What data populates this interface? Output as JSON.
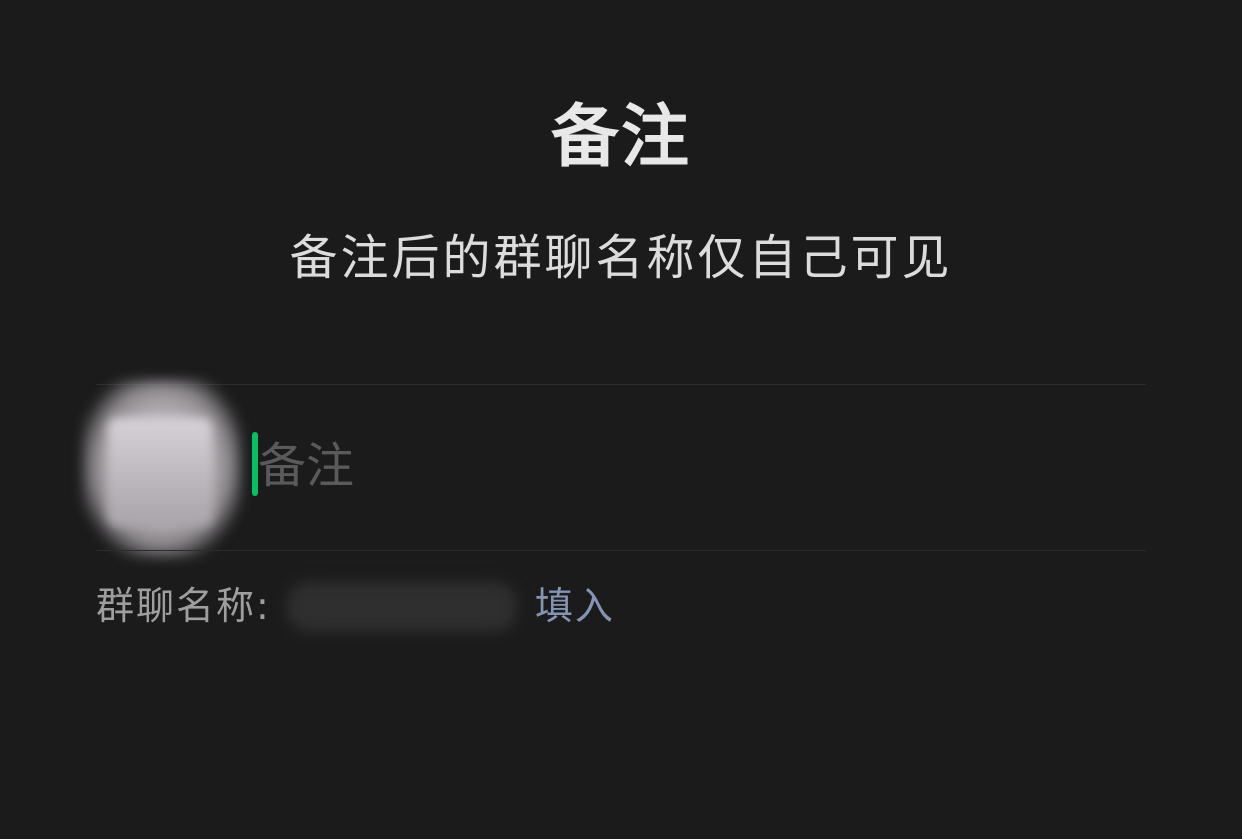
{
  "dialog": {
    "title": "备注",
    "subtitle": "备注后的群聊名称仅自己可见"
  },
  "remark_input": {
    "value": "",
    "placeholder": "备注"
  },
  "group_name_row": {
    "label": "群聊名称:",
    "action_label": "填入"
  },
  "colors": {
    "background": "#1b1b1b",
    "caret": "#07c160",
    "link": "#8494b3"
  },
  "icons": {
    "avatar": "group-avatar"
  }
}
